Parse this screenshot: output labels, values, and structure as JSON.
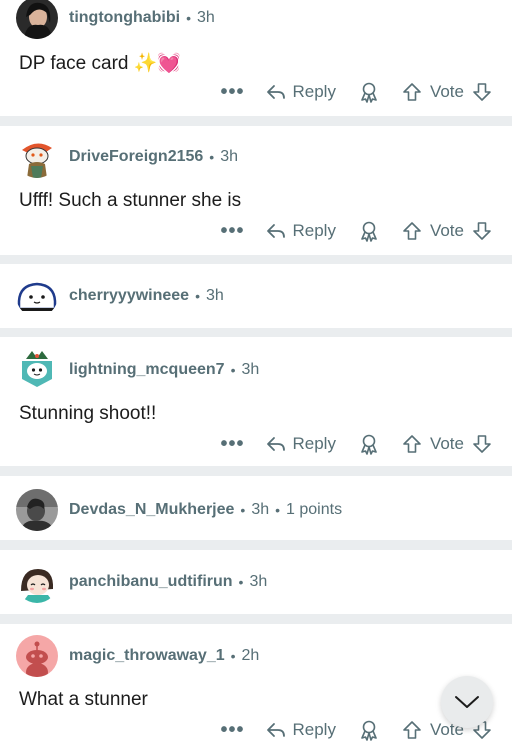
{
  "actions": {
    "more": "•••",
    "reply": "Reply",
    "vote": "Vote"
  },
  "comments": [
    {
      "user": "tingtonghabibi",
      "sep": "•",
      "time": "3h",
      "text": "DP face card ✨💓"
    },
    {
      "user": "DriveForeign2156",
      "sep": "•",
      "time": "3h",
      "text": "Ufff! Such a stunner she is"
    },
    {
      "user": "cherryyywineee",
      "sep": "•",
      "time": "3h"
    },
    {
      "user": "lightning_mcqueen7",
      "sep": "•",
      "time": "3h",
      "text": "Stunning shoot!!"
    },
    {
      "user": "Devdas_N_Mukherjee",
      "sep": "•",
      "time": "3h",
      "sep2": "•",
      "points": "1 points"
    },
    {
      "user": "panchibanu_udtifirun",
      "sep": "•",
      "time": "3h"
    },
    {
      "user": "magic_throwaway_1",
      "sep": "•",
      "time": "2h",
      "text": "What a stunner"
    }
  ],
  "icons": {
    "more": "more-horizontal-icon",
    "reply": "reply-arrow-icon",
    "award": "award-icon",
    "upvote": "upvote-arrow-icon",
    "downvote": "downvote-arrow-icon",
    "scroll": "chevron-down-icon"
  },
  "colors": {
    "meta": "#576f76",
    "divider": "#eaedef",
    "text": "#1c1c1c"
  }
}
